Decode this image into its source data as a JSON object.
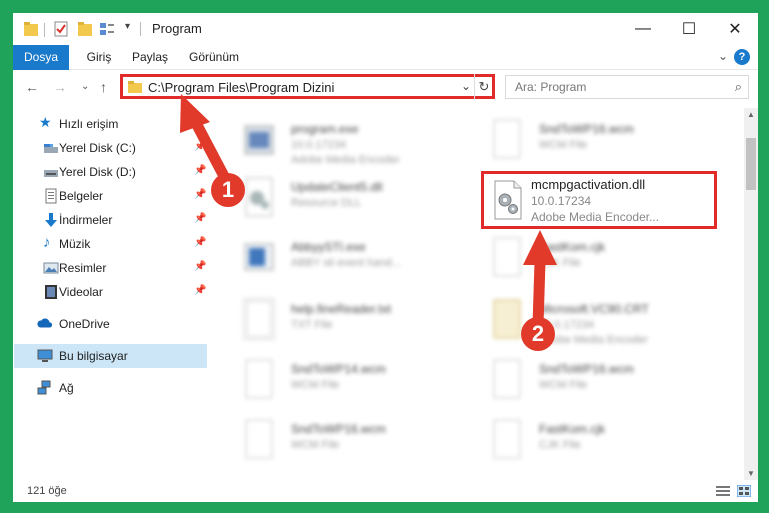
{
  "window": {
    "title": "Program"
  },
  "ribbon": {
    "tabs": [
      "Dosya",
      "Giriş",
      "Paylaş",
      "Görünüm"
    ],
    "help_label": "?"
  },
  "address": {
    "path": "C:\\Program Files\\Program Dizini"
  },
  "search": {
    "placeholder": "Ara: Program"
  },
  "sidebar": {
    "quick_access": "Hızlı erişim",
    "items": [
      {
        "label": "Yerel Disk (C:)",
        "icon": "drive-icon"
      },
      {
        "label": "Yerel Disk (D:)",
        "icon": "drive-icon"
      },
      {
        "label": "Belgeler",
        "icon": "documents-icon"
      },
      {
        "label": "İndirmeler",
        "icon": "download-icon"
      },
      {
        "label": "Müzik",
        "icon": "music-icon"
      },
      {
        "label": "Resimler",
        "icon": "pictures-icon"
      },
      {
        "label": "Videolar",
        "icon": "videos-icon"
      }
    ],
    "onedrive": "OneDrive",
    "this_pc": "Bu bilgisayar",
    "network": "Ağ"
  },
  "files": {
    "left": [
      {
        "name": "program.exe",
        "line2": "10.0.17234",
        "line3": "Adobe Media Encoder"
      },
      {
        "name": "UpdateClient5.dll",
        "line2": "Resource DLL",
        "line3": ""
      },
      {
        "name": "AbbyySTI.exe",
        "line2": "ABBY sti event hand...",
        "line3": ""
      },
      {
        "name": "help.fineReader.txt",
        "line2": "TXT File",
        "line3": ""
      },
      {
        "name": "SndToWP14.wcm",
        "line2": "WCM File",
        "line3": ""
      },
      {
        "name": "SndToWP16.wcm",
        "line2": "WCM File",
        "line3": ""
      }
    ],
    "right": [
      {
        "name": "SndToWP16.wcm",
        "line2": "WCM File",
        "line3": ""
      },
      {
        "name": "FastKom.cjk",
        "line2": "CJK File",
        "line3": ""
      },
      {
        "name": "Microsoft.VC90.CRT",
        "line2": "10.0.17234",
        "line3": "Adobe Media Encoder"
      },
      {
        "name": "SndToWP16.wcm",
        "line2": "WCM File",
        "line3": ""
      },
      {
        "name": "FastKom.cjk",
        "line2": "CJK File",
        "line3": ""
      }
    ],
    "highlighted": {
      "name": "mcmpgactivation.dll",
      "line2": "10.0.17234",
      "line3": "Adobe Media Encoder..."
    }
  },
  "status": {
    "count": "121 öğe"
  },
  "annotations": {
    "badge1": "1",
    "badge2": "2",
    "color": "#e13a2b"
  }
}
